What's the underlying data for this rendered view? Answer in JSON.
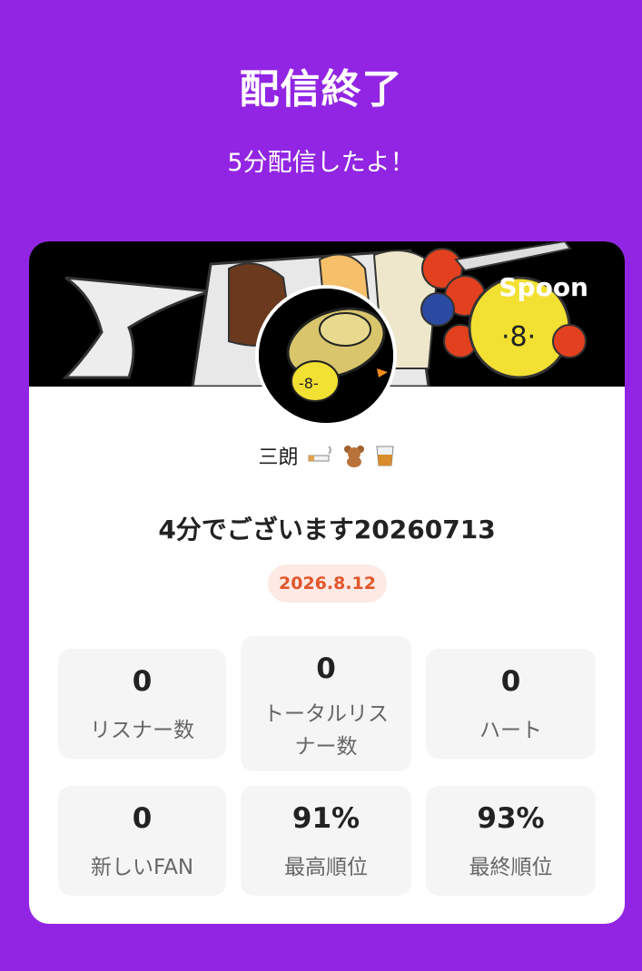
{
  "header": {
    "title": "配信終了",
    "subtitle": "5分配信したよ！"
  },
  "banner": {
    "logo_text": "Spoon",
    "image_desc_icon": "parfait-chick-illustration"
  },
  "profile": {
    "avatar_icon": "chick-with-hat-avatar",
    "username": "三朗",
    "username_emoji": [
      "cigarette-icon",
      "teddy-bear-icon",
      "whisky-glass-icon"
    ]
  },
  "live": {
    "title": "4分でございます20260713",
    "date": "2026.8.12"
  },
  "stats": [
    {
      "value": "0",
      "label": "リスナー数"
    },
    {
      "value": "0",
      "label": "トータルリスナー数"
    },
    {
      "value": "0",
      "label": "ハート"
    },
    {
      "value": "0",
      "label": "新しいFAN"
    },
    {
      "value": "91%",
      "label": "最高順位"
    },
    {
      "value": "93%",
      "label": "最終順位"
    }
  ],
  "colors": {
    "background": "#9225E3",
    "date_badge_bg": "#FDEAE4",
    "date_badge_text": "#E2562C",
    "stat_bg": "#F5F5F5"
  }
}
